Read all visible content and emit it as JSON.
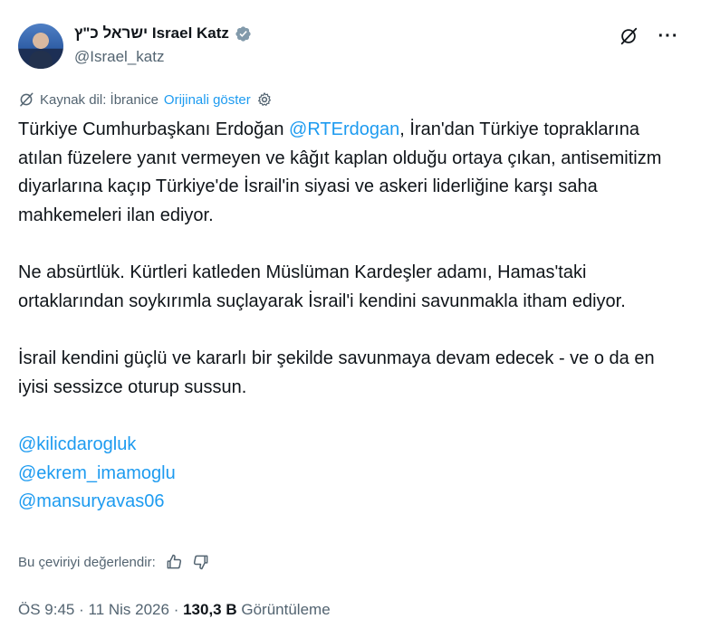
{
  "author": {
    "display_name": "ישראל כ\"ץ Israel Katz",
    "handle": "@Israel_katz"
  },
  "translation": {
    "source_label": "Kaynak dil: İbranice",
    "show_original": "Orijinali göster"
  },
  "tweet": {
    "p1_a": "Türkiye Cumhurbaşkanı Erdoğan ",
    "p1_mention": "@RTErdogan",
    "p1_b": ", İran'dan Türkiye topraklarına atılan füzelere yanıt vermeyen ve kâğıt kaplan olduğu ortaya çıkan, antisemitizm diyarlarına kaçıp Türkiye'de İsrail'in siyasi ve askeri liderliğine karşı saha mahkemeleri ilan ediyor.",
    "p2": "Ne absürtlük. Kürtleri katleden Müslüman Kardeşler adamı, Hamas'taki ortaklarından soykırımla suçlayarak İsrail'i kendini savunmakla itham ediyor.",
    "p3": "İsrail kendini güçlü ve kararlı bir şekilde savunmaya devam edecek - ve o da en iyisi sessizce oturup sussun.",
    "mentions": [
      "@kilicdarogluk",
      "@ekrem_imamoglu",
      "@mansuryavas06"
    ]
  },
  "rating": {
    "label": "Bu çeviriyi değerlendir:"
  },
  "meta": {
    "time": "ÖS 9:45",
    "date": "11 Nis 2026",
    "views_count": "130,3 B",
    "views_label": "Görüntüleme"
  },
  "colors": {
    "accent": "#1d9bf0",
    "secondary": "#536471",
    "text": "#0f1419"
  }
}
